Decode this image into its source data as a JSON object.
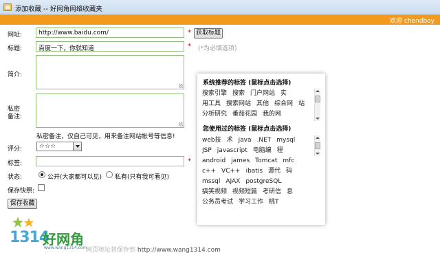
{
  "window": {
    "title": "添加收藏 -- 好网角网络收藏夹"
  },
  "header": {
    "welcome": "欢迎 chendboy"
  },
  "form": {
    "url_label": "网址:",
    "url_value": "http://www.baidu.com/",
    "fetch_title_button": "获取标题",
    "title_label": "标题:",
    "title_value": "百度一下，你就知道",
    "required_note": "(*为必填选项)",
    "intro_label": "简介:",
    "private_label_1": "私密",
    "private_label_2": "备注:",
    "private_hint": "私密备注，仅自己可见，用来备注网站帐号等信息!",
    "rating_label": "评分:",
    "rating_value": "☆☆☆",
    "tags_label": "标签:",
    "status_label": "状态:",
    "status_public": "公开(大家都可以见)",
    "status_private": "私有(只有我可看见)",
    "snapshot_label": "保存快照:",
    "save_button": "保存收藏",
    "required_mark": "*"
  },
  "tag_panel": {
    "recommended_title": "系统推荐的标签 (鼠标点击选择)",
    "recommended_tags": [
      "搜索引擎",
      "搜索",
      "门户网站",
      "实",
      "用工具",
      "搜索网站",
      "其他",
      "综合网",
      "站",
      "分析研究",
      "番茄花园",
      "我的网"
    ],
    "used_title": "您使用过的标签 (鼠标点击选择)",
    "used_tags": [
      "web技",
      "术",
      "java",
      ".NET",
      "mysql",
      "JSP",
      "javascript",
      "电脑编",
      "程",
      "android",
      "james",
      "Tomcat",
      "mfc",
      "c++",
      "VC++",
      "ibatis",
      "源代",
      "码",
      "mssql",
      "AJAX",
      "postgreSQL",
      "搞笑视频",
      "视频短篇",
      "考研信",
      "息",
      "公务员考试",
      "学习工作",
      "桃T"
    ]
  },
  "footer": {
    "logo_number": "1314",
    "logo_name": "好网角",
    "logo_site": "www.wang1314.com",
    "note": "网页地址将保存到",
    "note_url": "http://www.wang1314.com"
  },
  "colors": {
    "accent": "#f29a1d",
    "field_border": "#8fbf7a",
    "required": "#d4000b"
  }
}
